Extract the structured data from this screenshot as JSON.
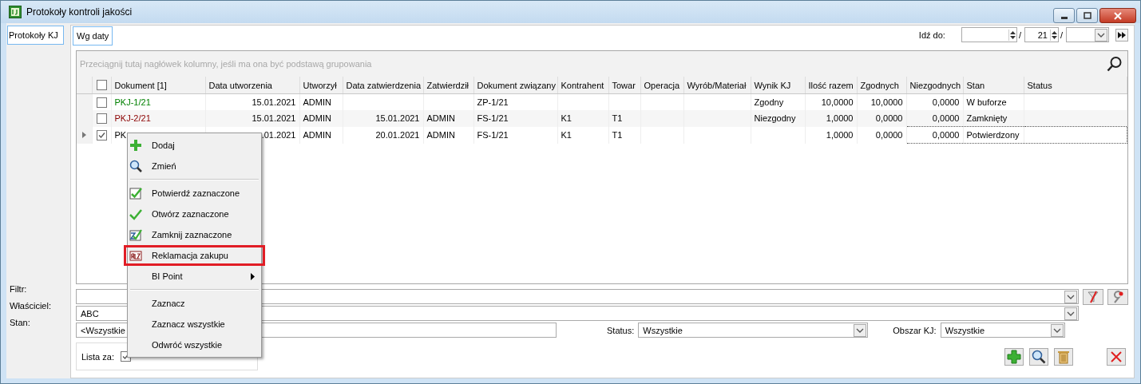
{
  "window": {
    "title": "Protokoły kontroli jakości"
  },
  "side_tabs": [
    {
      "label": "Protokoły KJ",
      "selected": true
    }
  ],
  "tabs": [
    {
      "label": "Wg daty",
      "selected": true
    }
  ],
  "go_to": {
    "label": "Idź do:",
    "separator_1": "/",
    "field_2": "21",
    "separator_2": "/"
  },
  "grid": {
    "group_hint": "Przeciągnij tutaj nagłówek kolumny, jeśli ma ona być podstawą grupowania",
    "header_checked": false,
    "columns": [
      {
        "label": "Dokument [1]"
      },
      {
        "label": "Data utworzenia"
      },
      {
        "label": "Utworzył"
      },
      {
        "label": "Data zatwierdzenia"
      },
      {
        "label": "Zatwierdził"
      },
      {
        "label": "Dokument związany"
      },
      {
        "label": "Kontrahent"
      },
      {
        "label": "Towar"
      },
      {
        "label": "Operacja"
      },
      {
        "label": "Wyrób/Materiał"
      },
      {
        "label": "Wynik KJ"
      },
      {
        "label": "Ilość razem"
      },
      {
        "label": "Zgodnych"
      },
      {
        "label": "Niezgodnych"
      },
      {
        "label": "Stan"
      },
      {
        "label": "Status"
      }
    ],
    "rows": [
      {
        "selected": false,
        "checked": false,
        "color": "#008000",
        "cells": [
          "PKJ-1/21",
          "15.01.2021",
          "ADMIN",
          "",
          "",
          "ZP-1/21",
          "",
          "",
          "",
          "",
          "Zgodny",
          "10,0000",
          "10,0000",
          "0,0000",
          "W buforze",
          ""
        ]
      },
      {
        "selected": false,
        "checked": false,
        "color": "#8b0000",
        "cells": [
          "PKJ-2/21",
          "15.01.2021",
          "ADMIN",
          "15.01.2021",
          "ADMIN",
          "FS-1/21",
          "K1",
          "T1",
          "",
          "",
          "Niezgodny",
          "1,0000",
          "0,0000",
          "0,0000",
          "Zamknięty",
          ""
        ]
      },
      {
        "selected": true,
        "checked": true,
        "color": "#000000",
        "cells": [
          "PK",
          ".01.2021",
          "ADMIN",
          "20.01.2021",
          "ADMIN",
          "FS-1/21",
          "K1",
          "T1",
          "",
          "",
          "",
          "1,0000",
          "0,0000",
          "0,0000",
          "Potwierdzony",
          ""
        ]
      }
    ]
  },
  "context_menu": {
    "groups": [
      [
        {
          "label": "Dodaj",
          "highlighted": false,
          "submenu": false
        },
        {
          "label": "Zmień",
          "highlighted": false,
          "submenu": false
        }
      ],
      [
        {
          "label": "Potwierdź zaznaczone",
          "highlighted": false,
          "submenu": false
        },
        {
          "label": "Otwórz zaznaczone",
          "highlighted": false,
          "submenu": false
        },
        {
          "label": "Zamknij zaznaczone",
          "highlighted": false,
          "submenu": false
        },
        {
          "label": "Reklamacja zakupu",
          "highlighted": true,
          "submenu": false
        },
        {
          "label": "BI Point",
          "highlighted": false,
          "submenu": true
        }
      ],
      [
        {
          "label": "Zaznacz",
          "highlighted": false,
          "submenu": false
        },
        {
          "label": "Zaznacz wszystkie",
          "highlighted": false,
          "submenu": false
        },
        {
          "label": "Odwróć wszystkie",
          "highlighted": false,
          "submenu": false
        }
      ]
    ]
  },
  "filters": {
    "filter_label": "Filtr:",
    "owner_label": "Właściciel:",
    "owner_value": "ABC",
    "state_label": "Stan:",
    "state_value": "<Wszystkie",
    "status_label": "Status:",
    "status_value": "Wszystkie",
    "area_label": "Obszar KJ:",
    "area_value": "Wszystkie",
    "list_label": "Lista za:",
    "list_checked": true
  }
}
